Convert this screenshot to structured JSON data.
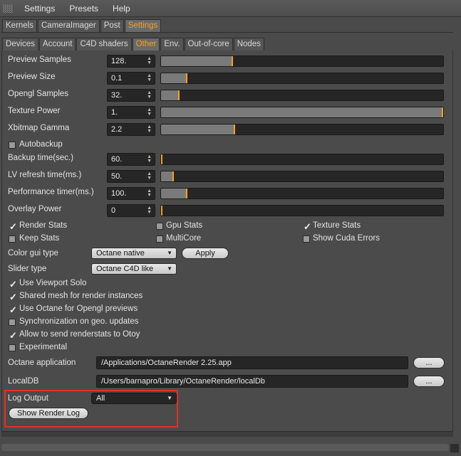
{
  "menubar": {
    "items": [
      "Settings",
      "Presets",
      "Help"
    ]
  },
  "tabs_main": [
    "Kernels",
    "CameraImager",
    "Post",
    "Settings"
  ],
  "tabs_main_active": 3,
  "tabs_sub": [
    "Devices",
    "Account",
    "C4D shaders",
    "Other",
    "Env.",
    "Out-of-core",
    "Nodes"
  ],
  "tabs_sub_active": 3,
  "colors": {
    "accent": "#f6a21d",
    "highlight_box": "#e0302a",
    "field_bg": "#262626"
  },
  "sliders": [
    {
      "label": "Preview Samples",
      "value": "128.",
      "level_pct": 25
    },
    {
      "label": "Preview Size",
      "value": "0.1",
      "level_pct": 9
    },
    {
      "label": "Opengl Samples",
      "value": "32.",
      "level_pct": 6
    },
    {
      "label": "Texture Power",
      "value": "1.",
      "level_pct": 100
    },
    {
      "label": "Xbitmap Gamma",
      "value": "2.2",
      "level_pct": 26
    }
  ],
  "autobackup": {
    "label": "Autobackup",
    "checked": false
  },
  "sliders2": [
    {
      "label": "Backup time(sec.)",
      "value": "60.",
      "level_pct": 0
    },
    {
      "label": "LV refresh time(ms.)",
      "value": "50.",
      "level_pct": 4
    },
    {
      "label": "Performance timer(ms.)",
      "value": "100.",
      "level_pct": 9
    },
    {
      "label": "Overlay Power",
      "value": "0",
      "level_pct": 0
    }
  ],
  "stats": {
    "render_stats": {
      "label": "Render Stats",
      "checked": true
    },
    "gpu_stats": {
      "label": "Gpu Stats",
      "checked": false
    },
    "texture_stats": {
      "label": "Texture Stats",
      "checked": true
    },
    "keep_stats": {
      "label": "Keep Stats",
      "checked": false
    },
    "multicore": {
      "label": "MultiCore",
      "checked": false
    },
    "cuda_errors": {
      "label": "Show Cuda Errors",
      "checked": false
    }
  },
  "color_gui": {
    "label": "Color gui type",
    "value": "Octane native",
    "apply": "Apply"
  },
  "slider_type": {
    "label": "Slider type",
    "value": "Octane C4D like"
  },
  "options": [
    {
      "label": "Use Viewport Solo",
      "checked": true
    },
    {
      "label": "Shared mesh for render instances",
      "checked": true
    },
    {
      "label": "Use Octane for Opengl previews",
      "checked": true
    },
    {
      "label": "Synchronization on geo. updates",
      "checked": false
    },
    {
      "label": "Allow to send renderstats to Otoy",
      "checked": true
    },
    {
      "label": "Experimental",
      "checked": false
    }
  ],
  "octane_app": {
    "label": "Octane application",
    "value": "/Applications/OctaneRender 2.25.app",
    "browse": "..."
  },
  "localdb": {
    "label": "LocalDB",
    "value": "/Users/barnapro/Library/OctaneRender/localDb",
    "browse": "..."
  },
  "log_output": {
    "label": "Log Output",
    "value": "All",
    "button": "Show Render Log"
  }
}
